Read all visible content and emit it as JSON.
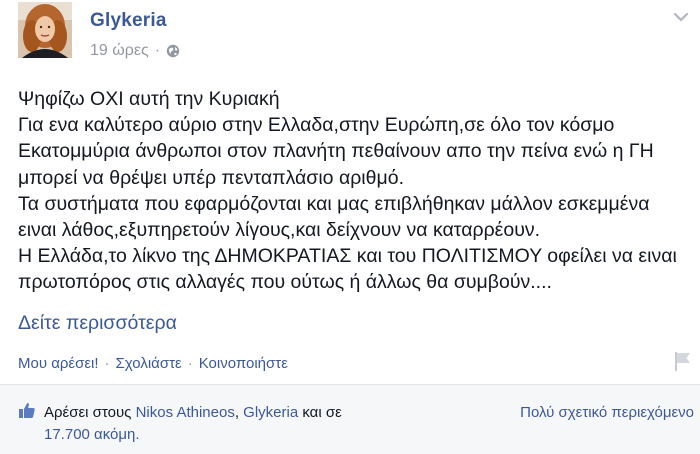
{
  "post": {
    "author": "Glykeria",
    "time": "19 ώρες",
    "separator": "·",
    "privacy_icon": "globe-icon",
    "menu_icon": "chevron-down-icon",
    "lines": [
      "Ψηφίζω ΟΧΙ αυτή την Κυριακή",
      "Για ενα καλύτερο αύριο στην Ελλαδα,στην Ευρώπη,σε όλο τον κόσμο",
      "Εκατομμύρια άνθρωποι στον πλανήτη πεθαίνουν απο την πείνα ενώ η ΓΗ",
      "μπορεί να θρέψει υπέρ πενταπλάσιο αριθμό.",
      "Τα συστήματα που εφαρμόζονται και μας επιβλήθηκαν μάλλον εσκεμμένα",
      "ειναι λάθος,εξυπηρετούν λίγους,και δείχνουν να καταρρέουν.",
      "Η Ελλάδα,το λίκνο της ΔΗΜΟΚΡΑΤΙΑΣ και του ΠΟΛΙΤΙΣΜΟΥ οφείλει να ειναι",
      "πρωτοπόρος στις αλλαγές που ούτως ή άλλως θα συμβούν...."
    ],
    "see_more": "Δείτε περισσότερα"
  },
  "actions": {
    "like": "Μου αρέσει!",
    "comment": "Σχολιάστε",
    "share": "Κοινοποιήστε",
    "separator": "·"
  },
  "likes": {
    "prefix": "Αρέσει στους",
    "user1": "Nikos Athineos",
    "comma": ",",
    "user2": "Glykeria",
    "and": "και σε",
    "others": "17.700 ακόμη.",
    "relevant": "Πολύ σχετικό περιεχόμενο"
  },
  "colors": {
    "link": "#3b5998",
    "meta": "#9197a3",
    "text": "#141823",
    "likes_bg": "#f6f7f9"
  }
}
